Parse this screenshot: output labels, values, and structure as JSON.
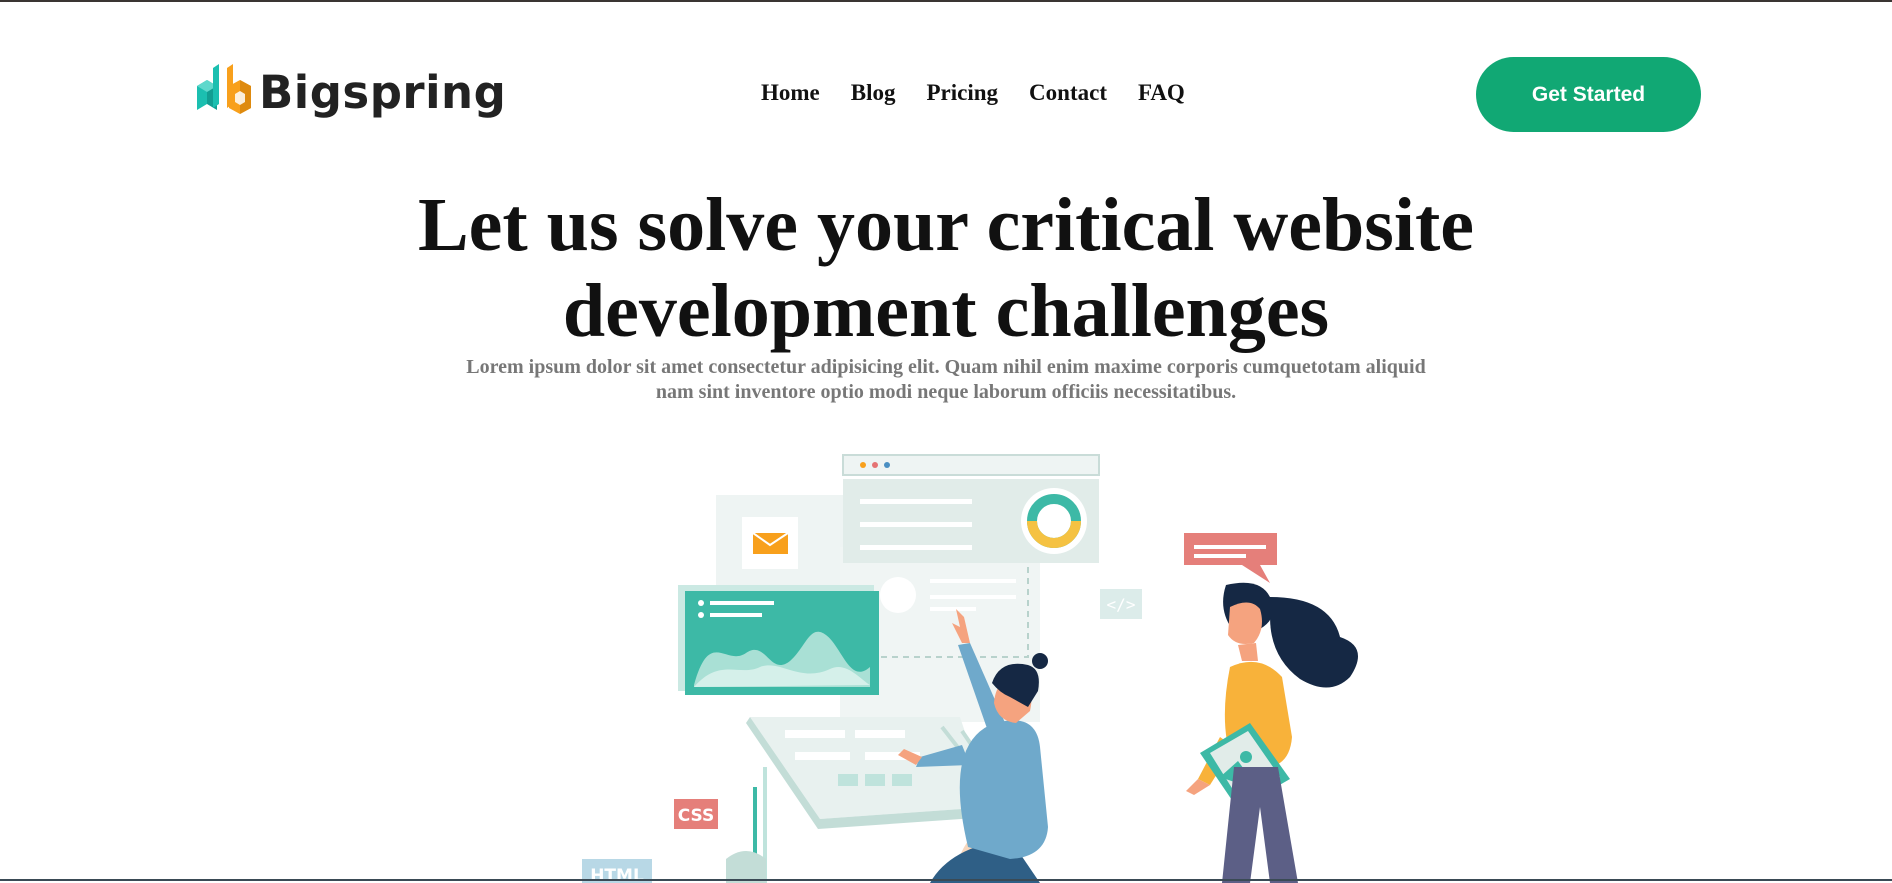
{
  "brand": {
    "name": "Bigspring",
    "colors": {
      "teal": "#1bbfb0",
      "orange": "#f8a01c",
      "accent": "#11a874"
    }
  },
  "nav": {
    "items": [
      "Home",
      "Blog",
      "Pricing",
      "Contact",
      "FAQ"
    ]
  },
  "cta": {
    "label": "Get Started"
  },
  "hero": {
    "title_line1": "Let us solve your critical website",
    "title_line2": "development challenges",
    "subtitle_line1": "Lorem ipsum dolor sit amet consectetur adipisicing elit. Quam nihil enim maxime corporis cumquetotam aliquid",
    "subtitle_line2": "nam sint inventore optio modi neque laborum officiis necessitatibus."
  },
  "illustration": {
    "tags": {
      "css": "CSS",
      "html": "HTML",
      "code": "</>"
    },
    "icons": [
      "mail-icon",
      "donut-chart-icon",
      "area-chart-icon",
      "speech-bubble-icon",
      "code-tag-icon",
      "image-icon"
    ]
  }
}
